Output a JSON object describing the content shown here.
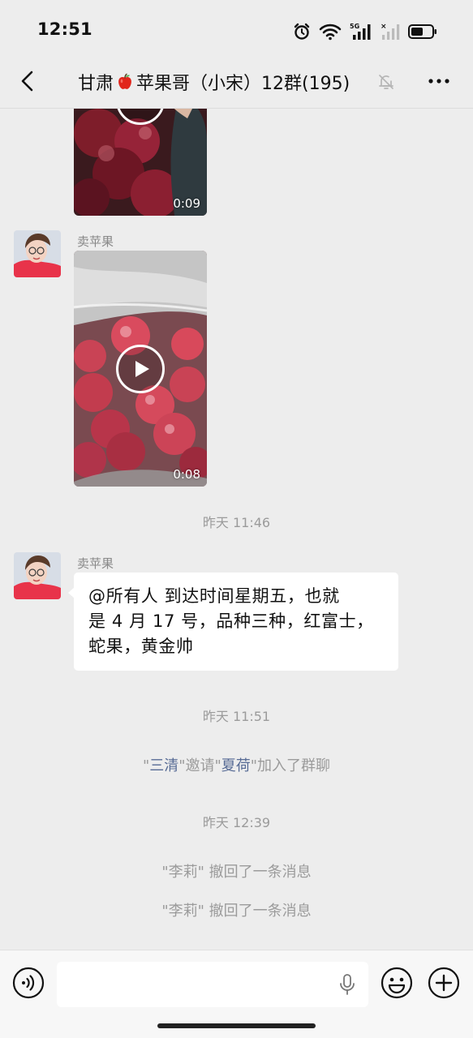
{
  "status_bar": {
    "time": "12:51",
    "network": "5G",
    "icons": [
      "alarm-icon",
      "wifi-icon",
      "signal-5g-icon",
      "signal-no-service-icon",
      "battery-icon"
    ]
  },
  "header": {
    "title_part1": "甘肃",
    "title_emoji": "apple-emoji",
    "title_part2": "苹果哥（小宋）12群(195)",
    "muted_icon": "bell-muted-icon",
    "back_icon": "chevron-left-icon",
    "more_icon": "more-dots-icon"
  },
  "messages": {
    "video1": {
      "duration": "0:09"
    },
    "msg2": {
      "sender": "卖苹果",
      "duration": "0:08"
    },
    "ts1": "昨天 11:46",
    "msg3": {
      "sender": "卖苹果",
      "text_line1": "@所有人  到达时间星期五，也就",
      "text_line2": "是 4 月 17 号，品种三种，红富士，",
      "text_line3": "蛇果，黄金帅"
    },
    "ts2": "昨天 11:51",
    "sys1": {
      "q1": "\"",
      "inviter": "三清",
      "mid": "\"邀请\"",
      "invitee": "夏荷",
      "tail": "\"加入了群聊"
    },
    "ts3": "昨天 12:39",
    "recall1": "\"李莉\" 撤回了一条消息",
    "recall2": "\"李莉\" 撤回了一条消息"
  },
  "input_bar": {
    "value": "",
    "voice_icon": "voice-icon",
    "mic_icon": "microphone-icon",
    "emoji_icon": "emoji-icon",
    "plus_icon": "plus-icon"
  },
  "colors": {
    "background": "#ededed",
    "link_name": "#576b95",
    "muted_text": "#9b9b9b"
  }
}
